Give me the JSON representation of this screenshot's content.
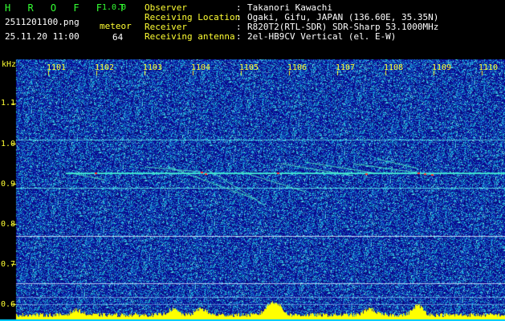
{
  "app": {
    "title": "H R O F F T",
    "version": "1.0.0"
  },
  "file_name": "2511201100.png",
  "timestamp": "25.11.20 11:00",
  "meteor": {
    "label": "meteor",
    "count": "64"
  },
  "info": [
    {
      "label": "Observer",
      "value": "Takanori Kawachi"
    },
    {
      "label": "Receiving Location",
      "value": "Ogaki, Gifu, JAPAN (136.60E, 35.35N)"
    },
    {
      "label": "Receiver",
      "value": "R820T2(RTL-SDR) SDR-Sharp 53.1000MHz"
    },
    {
      "label": "Receiving antenna",
      "value": "2el-HB9CV Vertical (el. E-W)"
    }
  ],
  "separator": ":",
  "y_axis": {
    "unit": "kHz",
    "ticks": [
      "1.1",
      "1.0",
      "0.9",
      "0.8",
      "0.7",
      "0.6"
    ]
  },
  "x_axis": {
    "ticks": [
      "1101",
      "1102",
      "1103",
      "1104",
      "1105",
      "1106",
      "1107",
      "1108",
      "1109",
      "1110"
    ]
  },
  "colors": {
    "background": "#000000",
    "noise_blue": "#1010a0",
    "accent_green": "#33ff33",
    "accent_yellow": "#ffff33",
    "carrier_cyan": "#40e0d0",
    "signal_red": "#ff3030"
  }
}
